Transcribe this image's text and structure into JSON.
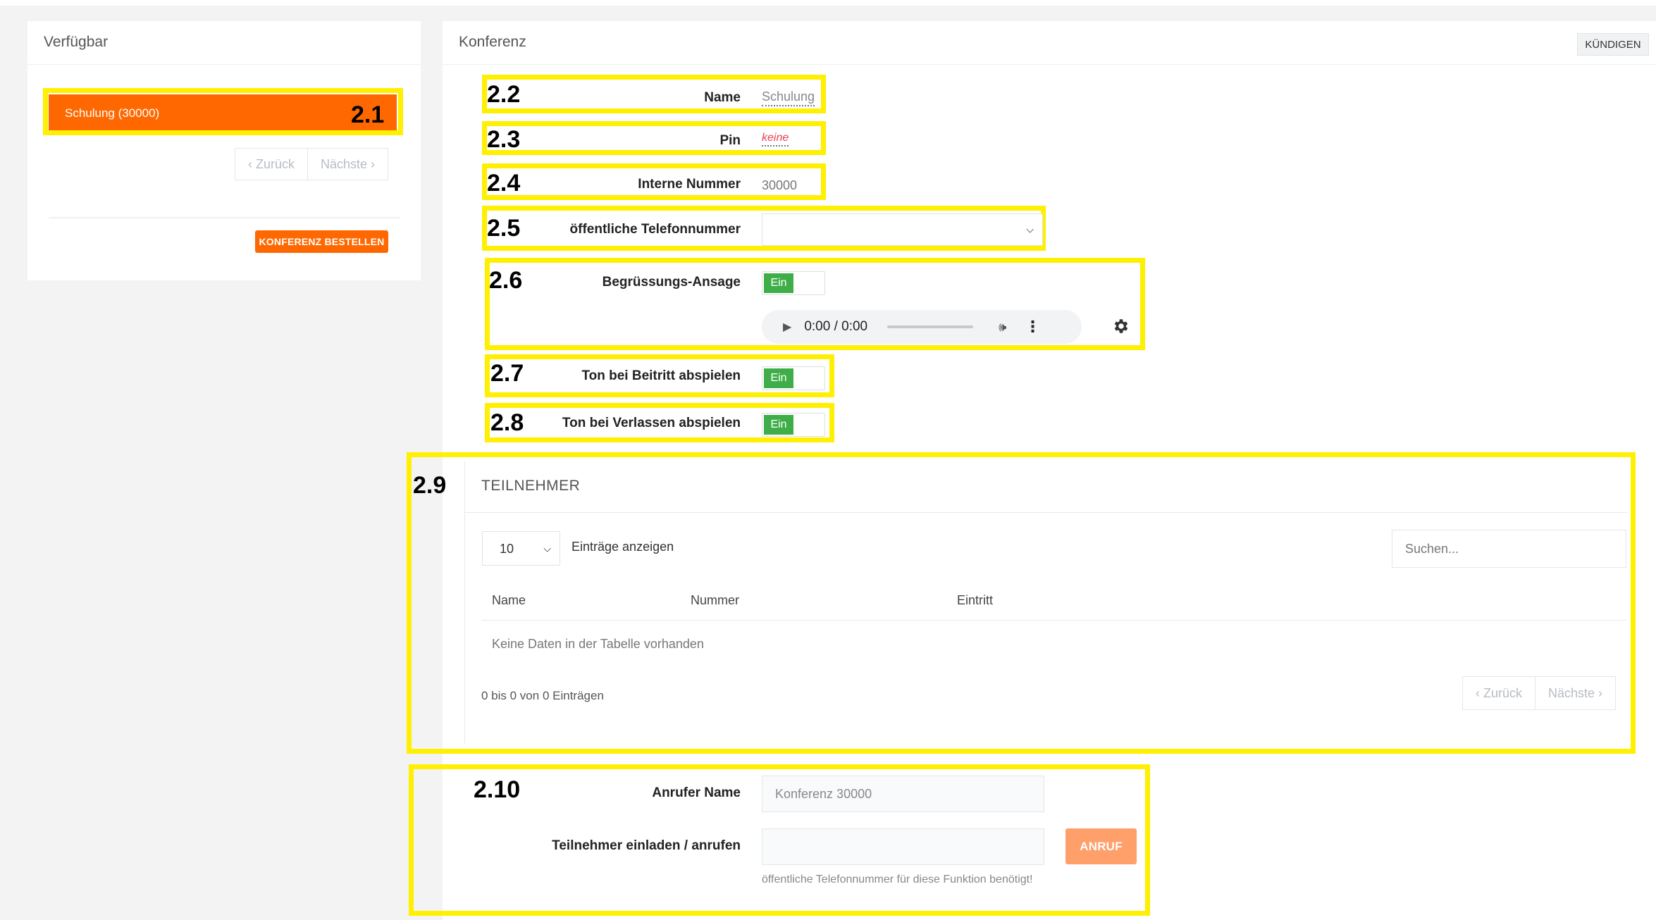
{
  "left_panel": {
    "title": "Verfügbar",
    "conference_item": "Schulung (30000)",
    "pager": {
      "prev": "‹ Zurück",
      "next": "Nächste ›"
    },
    "order_button": "KONFERENZ BESTELLEN"
  },
  "right_panel": {
    "title": "Konferenz",
    "cancel_button": "KÜNDIGEN",
    "fields": {
      "name_label": "Name",
      "name_value": "Schulung",
      "pin_label": "Pin",
      "pin_value": "keine",
      "internal_label": "Interne Nummer",
      "internal_value": "30000",
      "public_phone_label": "öffentliche Telefonnummer",
      "public_phone_value": "",
      "greeting_label": "Begrüssungs-Ansage",
      "greeting_toggle": "Ein",
      "audio_time": "0:00 / 0:00",
      "join_tone_label": "Ton bei Beitritt abspielen",
      "join_tone_toggle": "Ein",
      "leave_tone_label": "Ton bei Verlassen abspielen",
      "leave_tone_toggle": "Ein"
    },
    "participants": {
      "title": "TEILNEHMER",
      "page_size": "10",
      "page_size_label": "Einträge anzeigen",
      "search_placeholder": "Suchen...",
      "columns": [
        "Name",
        "Nummer",
        "Eintritt"
      ],
      "empty_text": "Keine Daten in der Tabelle vorhanden",
      "info": "0 bis 0 von 0 Einträgen",
      "pager": {
        "prev": "‹ Zurück",
        "next": "Nächste ›"
      }
    },
    "call": {
      "caller_name_label": "Anrufer Name",
      "caller_name_placeholder": "Konferenz 30000",
      "invite_label": "Teilnehmer einladen / anrufen",
      "invite_value": "",
      "call_button": "ANRUF",
      "help_text": "öffentliche Telefonnummer für diese Funktion benötigt!"
    }
  },
  "annotations": [
    "2.1",
    "2.2",
    "2.3",
    "2.4",
    "2.5",
    "2.6",
    "2.7",
    "2.8",
    "2.9",
    "2.10"
  ],
  "colors": {
    "accent": "#ff6800",
    "toggle_on": "#3fae49",
    "annotation": "#ffef00",
    "pin_none": "#ec3f55"
  }
}
